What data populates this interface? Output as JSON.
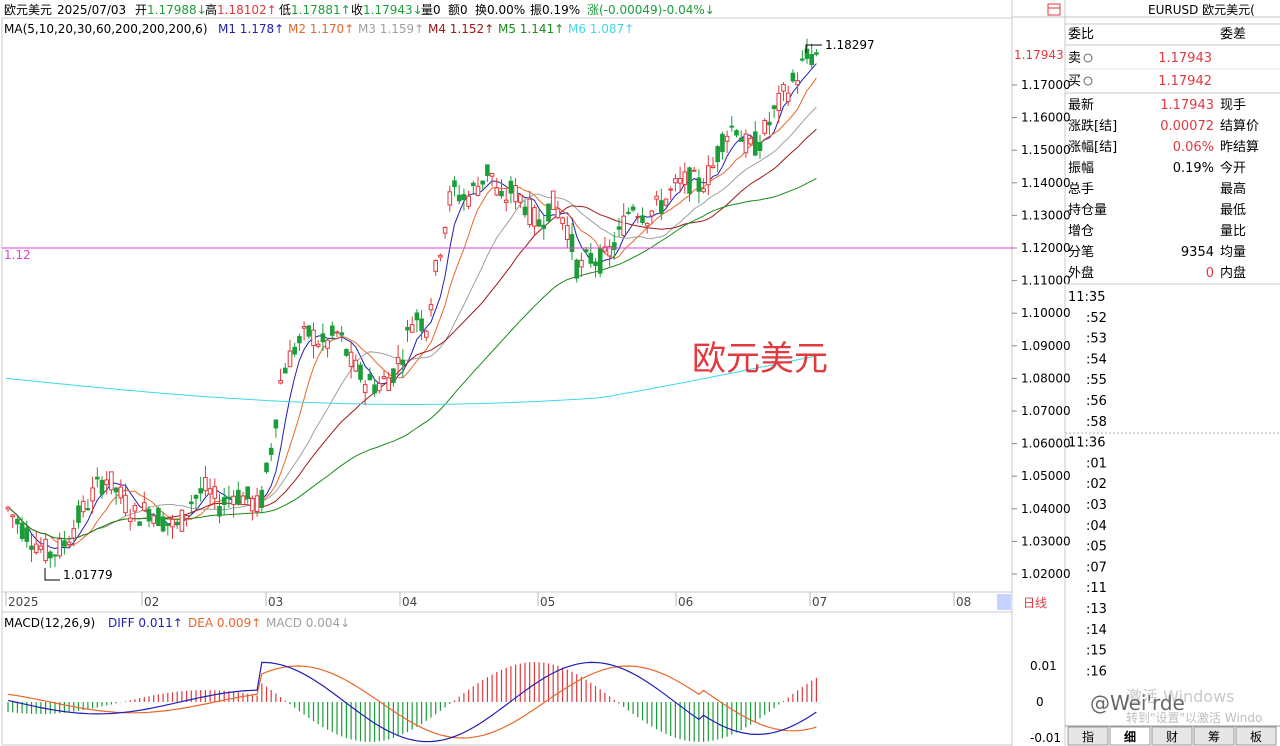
{
  "header": {
    "name": "欧元美元",
    "date": "2025/07/03",
    "open_label": "开",
    "open": "1.17988",
    "high_label": "高",
    "high": "1.18102",
    "low_label": "低",
    "low": "1.17881",
    "close_label": "收",
    "close": "1.17943",
    "vol_label": "量0",
    "amt_label": "额0",
    "turnover_label": "换0.00%",
    "amplitude_label": "振0.19%",
    "change_label": "涨(-0.00049)-0.04%",
    "arrow_down": "↓",
    "arrow_up": "↑"
  },
  "ma_line": {
    "label": "MA(5,10,20,30,60,200,200,200,6)",
    "items": [
      {
        "name": "M1",
        "value": "1.178↑",
        "color": "#1f1fb4"
      },
      {
        "name": "M2",
        "value": "1.170↑",
        "color": "#e8672b"
      },
      {
        "name": "M3",
        "value": "1.159↑",
        "color": "#a0a0a0"
      },
      {
        "name": "M4",
        "value": "1.152↑",
        "color": "#a01818"
      },
      {
        "name": "M5",
        "value": "1.141↑",
        "color": "#1a8c1a"
      },
      {
        "name": "M6",
        "value": "1.087↑",
        "color": "#3fd9e6"
      }
    ]
  },
  "price_axis": {
    "labels": [
      "1.17000",
      "1.16000",
      "1.15000",
      "1.14000",
      "1.13000",
      "1.12000",
      "1.11000",
      "1.10000",
      "1.09000",
      "1.08000",
      "1.07000",
      "1.06000",
      "1.05000",
      "1.04000",
      "1.03000",
      "1.02000"
    ],
    "current": "1.17943"
  },
  "hline_label": "1.12",
  "high_marker": "1.18297",
  "low_marker": "1.01779",
  "watermark": "欧元美元",
  "x_axis": {
    "labels": [
      "2025",
      "02",
      "03",
      "04",
      "05",
      "06",
      "07",
      "08"
    ],
    "period_button": "日线"
  },
  "macd": {
    "label": "MACD(12,26,9)",
    "diff": "DIFF 0.011↑",
    "dea": "DEA 0.009↑",
    "macd": "MACD 0.004↓",
    "axis": [
      "0.01",
      "0",
      "-0.01"
    ]
  },
  "colors": {
    "up": "#e0393e",
    "down": "#1b9e3a",
    "diff": "#1f1fb4",
    "dea": "#e8672b",
    "hline": "#e040e0",
    "label_blue": "#1f1fb4"
  },
  "right_panel": {
    "title": "EURUSD 欧元美元(",
    "header_left": "委比",
    "header_right": "委差",
    "sell_label": "卖",
    "sell_value": "1.17943",
    "buy_label": "买",
    "buy_value": "1.17942",
    "rows": [
      {
        "l1": "最新",
        "v1": "1.17943",
        "l2": "现手",
        "v2": ""
      },
      {
        "l1": "涨跌[结]",
        "v1": "0.00072",
        "l2": "结算价",
        "v2": ""
      },
      {
        "l1": "涨幅[结]",
        "v1": "0.06%",
        "l2": "昨结算",
        "v2": ""
      },
      {
        "l1": "振幅",
        "v1": "0.19%",
        "l2": "今开",
        "v2": ""
      },
      {
        "l1": "总手",
        "v1": "",
        "l2": "最高",
        "v2": ""
      },
      {
        "l1": "持仓量",
        "v1": "",
        "l2": "最低",
        "v2": ""
      },
      {
        "l1": "增仓",
        "v1": "",
        "l2": "量比",
        "v2": ""
      },
      {
        "l1": "分笔",
        "v1": "9354",
        "l2": "均量",
        "v2": ""
      },
      {
        "l1": "外盘",
        "v1": "0",
        "l2": "内盘",
        "v2": ""
      }
    ],
    "ticks": [
      "11:35",
      ":52",
      ":53",
      ":54",
      ":55",
      ":56",
      ":58",
      "11:36",
      ":01",
      ":02",
      ":03",
      ":04",
      ":05",
      ":07",
      ":11",
      ":13",
      ":14",
      ":15",
      ":16"
    ],
    "tabs": [
      "指",
      "细",
      "财",
      "筹",
      "板"
    ],
    "active_tab": 1
  },
  "overlay": {
    "brand": "@Wei'rde",
    "activate1": "激活 Windows",
    "activate2": "转到\"设置\"以激活 Windo"
  }
}
